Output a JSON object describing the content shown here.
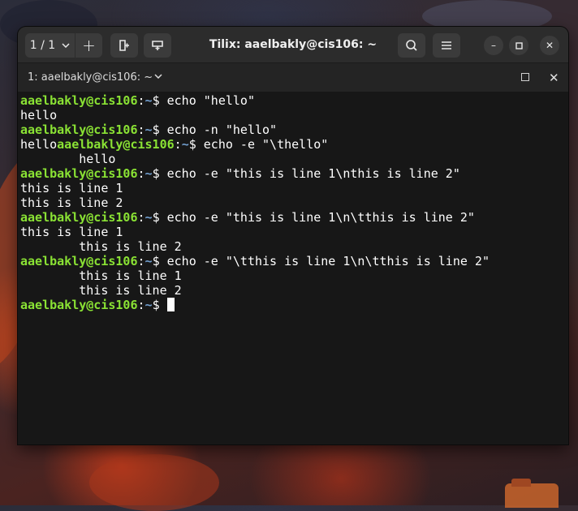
{
  "window": {
    "title": "Tilix: aaelbakly@cis106: ~",
    "session_selector": "1 / 1",
    "add_label": "+",
    "min_label": "–",
    "close_label": "✕"
  },
  "tab": {
    "label": "1: aaelbakly@cis106: ~",
    "close_label": "✕"
  },
  "terminal": {
    "prompt_user": "aaelbakly@cis106",
    "prompt_path": "~",
    "lines": [
      {
        "prompt": true,
        "pre": "",
        "cmd": " echo \"hello\""
      },
      {
        "prompt": false,
        "text": "hello"
      },
      {
        "prompt": true,
        "pre": "",
        "cmd": " echo -n \"hello\""
      },
      {
        "prompt": true,
        "pre": "hello",
        "cmd": " echo -e \"\\thello\""
      },
      {
        "prompt": false,
        "text": "        hello"
      },
      {
        "prompt": true,
        "pre": "",
        "cmd": " echo -e \"this is line 1\\nthis is line 2\""
      },
      {
        "prompt": false,
        "text": "this is line 1"
      },
      {
        "prompt": false,
        "text": "this is line 2"
      },
      {
        "prompt": true,
        "pre": "",
        "cmd": " echo -e \"this is line 1\\n\\tthis is line 2\""
      },
      {
        "prompt": false,
        "text": "this is line 1"
      },
      {
        "prompt": false,
        "text": "        this is line 2"
      },
      {
        "prompt": true,
        "pre": "",
        "cmd": " echo -e \"\\tthis is line 1\\n\\tthis is line 2\""
      },
      {
        "prompt": false,
        "text": "        this is line 1"
      },
      {
        "prompt": false,
        "text": "        this is line 2"
      },
      {
        "prompt": true,
        "pre": "",
        "cmd": " ",
        "cursor": true
      }
    ]
  },
  "colors": {
    "prompt_user": "#8ae234",
    "prompt_path": "#729fcf",
    "terminal_bg": "#171717",
    "titlebar_bg": "#2c2c2c"
  }
}
